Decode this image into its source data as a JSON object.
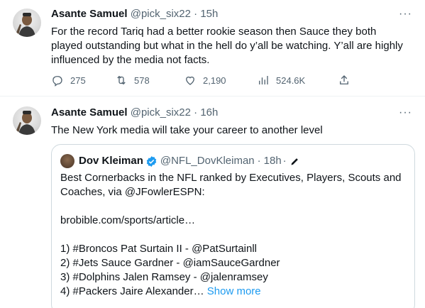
{
  "tweets": [
    {
      "author_name": "Asante Samuel",
      "author_handle": "@pick_six22",
      "separator": "·",
      "time": "15h",
      "more_label": "···",
      "text": "For the record Tariq had a better rookie season then Sauce they both played outstanding but what in the hell do y’all be watching. Y’all are highly influenced by the media not facts.",
      "replies": "275",
      "retweets": "578",
      "likes": "2,190",
      "views": "524.6K"
    },
    {
      "author_name": "Asante Samuel",
      "author_handle": "@pick_six22",
      "separator": "·",
      "time": "16h",
      "more_label": "···",
      "text": "The New York media will take your career to another level"
    }
  ],
  "quote": {
    "author_name": "Dov Kleiman",
    "author_handle": "@NFL_DovKleiman",
    "separator": "·",
    "time": "18h",
    "trailing_separator": "·",
    "lines": [
      "Best Cornerbacks in the NFL ranked by Executives, Players, Scouts and",
      "Coaches, via @JFowlerESPN:",
      "",
      "brobible.com/sports/article…",
      "",
      "1) #Broncos Pat Surtain II - @PatSurtainll",
      "2) #Jets Sauce Gardner - @iamSauceGardner",
      "3) #Dolphins Jalen Ramsey - @jalenramsey",
      "4)  #Packers Jaire Alexander…"
    ],
    "show_more": "Show more"
  },
  "colors": {
    "text": "#0f1419",
    "secondary": "#536471",
    "link": "#1d9bf0",
    "border": "#cfd9de",
    "divider": "#eff3f4",
    "verified": "#1d9bf0"
  },
  "icons": [
    "reply-icon",
    "retweet-icon",
    "like-icon",
    "views-icon",
    "share-icon",
    "more-icon",
    "verified-badge-icon",
    "edit-pencil-icon"
  ]
}
